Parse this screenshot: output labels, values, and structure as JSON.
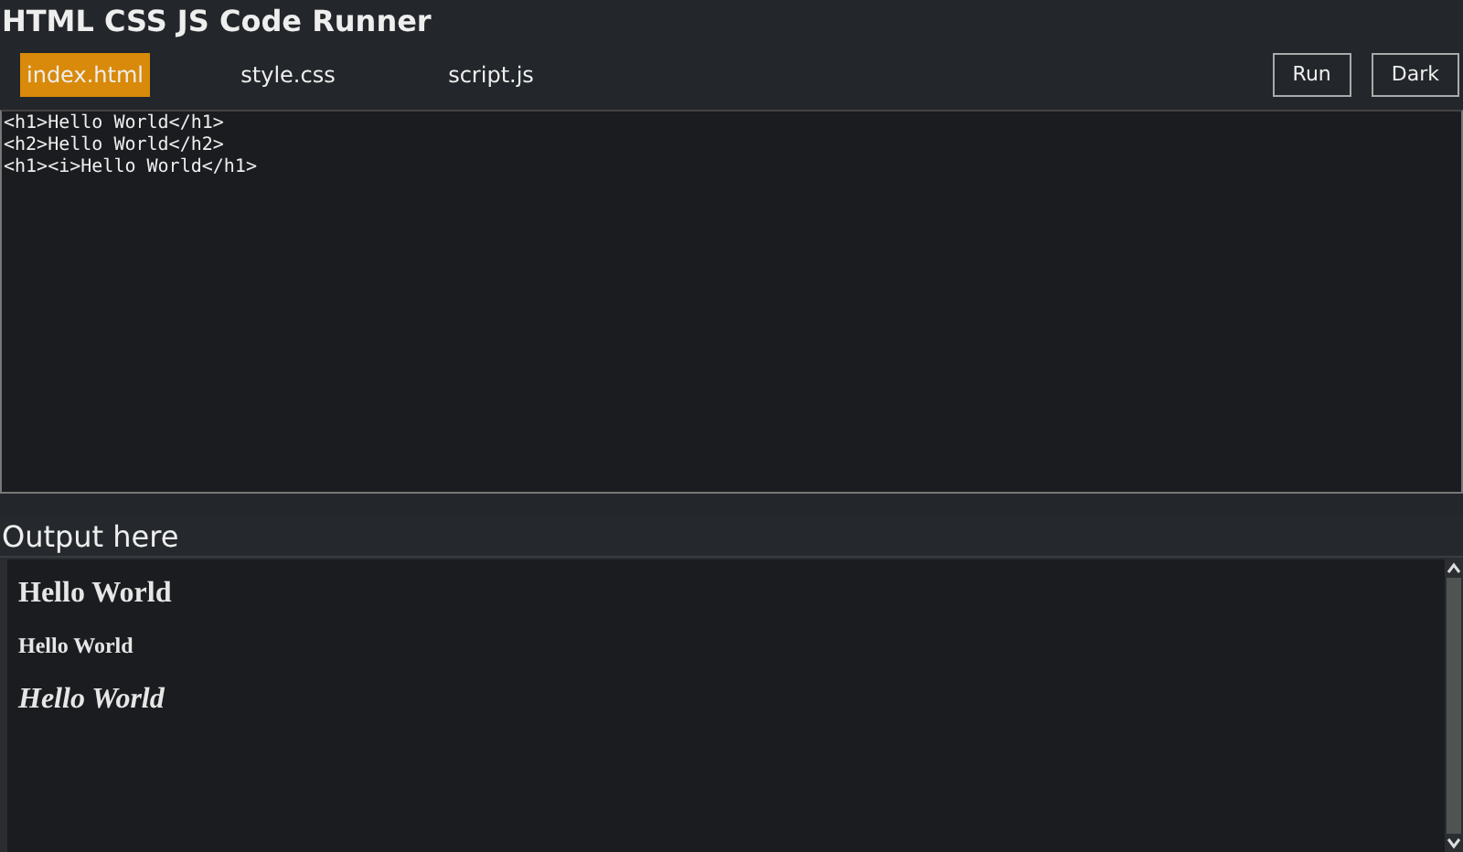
{
  "app": {
    "title": "HTML CSS JS Code Runner"
  },
  "tabs": [
    {
      "label": "index.html",
      "selected": true
    },
    {
      "label": "style.css",
      "selected": false
    },
    {
      "label": "script.js",
      "selected": false
    }
  ],
  "buttons": [
    "Run",
    "Dark"
  ],
  "editor": {
    "lines": [
      "<h1>Hello World</h1>",
      "<h2>Hello World</h2>",
      "<h1><i>Hello World</h1>"
    ]
  },
  "output": {
    "heading": "Output here",
    "items": [
      {
        "kind": "h1",
        "text": "Hello World",
        "italic": false
      },
      {
        "kind": "h2",
        "text": "Hello World",
        "italic": false
      },
      {
        "kind": "h1",
        "text": "Hello World",
        "italic": true
      }
    ]
  }
}
